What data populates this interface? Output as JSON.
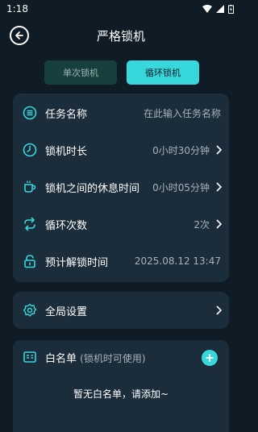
{
  "status_bar": {
    "time": "1:18"
  },
  "header": {
    "title": "严格锁机"
  },
  "tabs": [
    {
      "label": "单次锁机",
      "active": false
    },
    {
      "label": "循环锁机",
      "active": true
    }
  ],
  "settings": {
    "task_name": {
      "label": "任务名称",
      "placeholder": "在此输入任务名称",
      "icon": "task-list-icon"
    },
    "lock_duration": {
      "label": "锁机时长",
      "value": "0小时30分钟",
      "icon": "clock-icon"
    },
    "rest_time": {
      "label": "锁机之间的休息时间",
      "value": "0小时05分钟",
      "icon": "coffee-cup-icon"
    },
    "loop_count": {
      "label": "循环次数",
      "value": "2次",
      "icon": "repeat-icon"
    },
    "unlock_time": {
      "label": "预计解锁时间",
      "value": "2025.08.12 13:47",
      "icon": "lock-icon"
    }
  },
  "global_settings": {
    "label": "全局设置",
    "icon": "gear-icon"
  },
  "whitelist": {
    "title": "白名单",
    "subtitle": "(锁机时可使用)",
    "empty_text": "暂无白名单，请添加~",
    "icon": "id-card-icon"
  },
  "colors": {
    "accent": "#37d7dc",
    "background": "#0f1c25",
    "card": "#1b2d3a",
    "muted_text": "#a5b3bc"
  }
}
